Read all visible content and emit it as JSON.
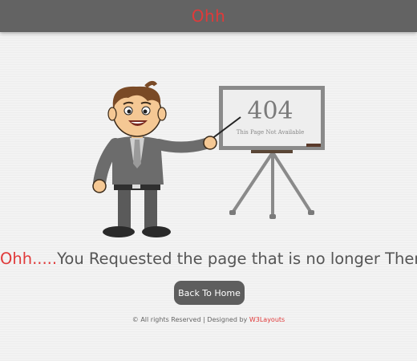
{
  "header": {
    "logo_text": "Ohh"
  },
  "board": {
    "code": "404",
    "subtitle": "This Page Not Available"
  },
  "message": {
    "prefix": "Ohh.....",
    "text": "You Requested the page that is no longer There."
  },
  "back_button": {
    "label": "Back To Home"
  },
  "footer": {
    "copyright": "© All rights Reserved  |  Designed by ",
    "brand": "W3Layouts"
  },
  "colors": {
    "accent": "#e03a3a",
    "header_bg": "#636363",
    "button_bg": "#5e5e5e"
  }
}
